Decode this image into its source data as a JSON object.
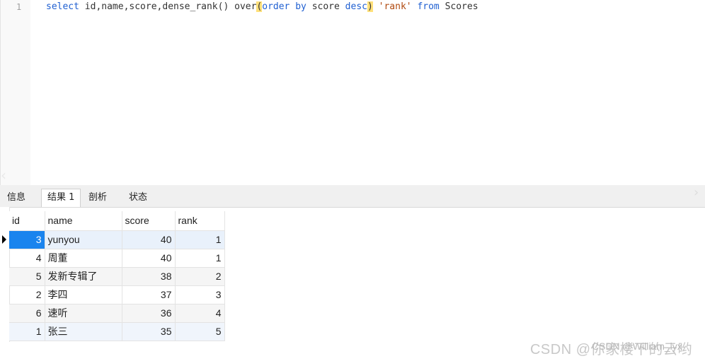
{
  "editor": {
    "line_number": "1",
    "code_parts": {
      "p1": "select id,name,score,dense_rank() over",
      "p2": "(",
      "p3": "order by",
      "p4": " score ",
      "p5": "desc",
      "p6": ")",
      "p7": " ",
      "p8": "'rank'",
      "p9": " ",
      "p10": "from",
      "p11": " Scores"
    }
  },
  "tabs": [
    {
      "label": "信息"
    },
    {
      "label": "结果 1"
    },
    {
      "label": "剖析"
    },
    {
      "label": "状态"
    }
  ],
  "result_grid": {
    "columns": [
      "id",
      "name",
      "score",
      "rank"
    ],
    "rows": [
      {
        "id": "3",
        "name": "yunyou",
        "score": "40",
        "rank": "1"
      },
      {
        "id": "4",
        "name": "周董",
        "score": "40",
        "rank": "1"
      },
      {
        "id": "5",
        "name": "发新专辑了",
        "score": "38",
        "rank": "2"
      },
      {
        "id": "2",
        "name": "李四",
        "score": "37",
        "rank": "3"
      },
      {
        "id": "6",
        "name": "速听",
        "score": "36",
        "rank": "4"
      },
      {
        "id": "1",
        "name": "张三",
        "score": "35",
        "rank": "5"
      }
    ]
  },
  "watermark": {
    "text": "CSDN @你家楼下的云哟",
    "overlay": "CSDN @William_lyx"
  },
  "colors": {
    "keyword": "#1f5fd1",
    "string": "#b14a10",
    "selected_cell": "#1a84ee",
    "paren_highlight": "#ffe07a"
  }
}
